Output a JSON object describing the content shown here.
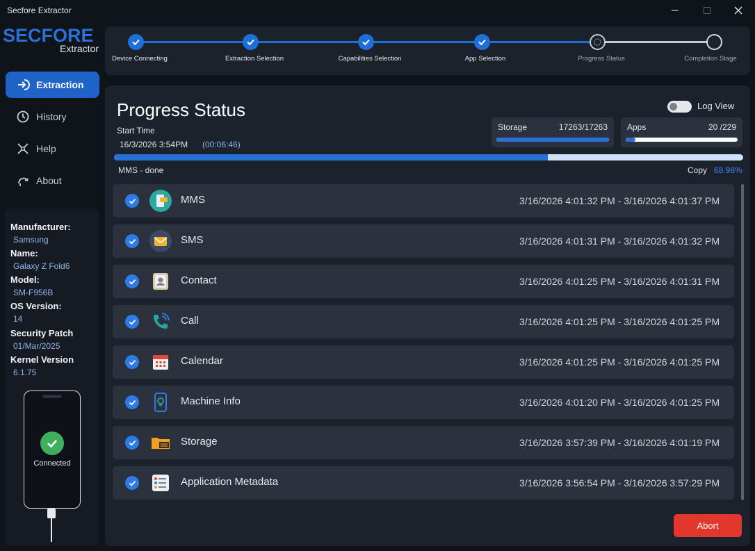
{
  "window": {
    "title": "Secfore Extractor"
  },
  "logo": {
    "main": "SECFORE",
    "sub": "Extractor"
  },
  "nav": [
    {
      "label": "Extraction",
      "icon": "extraction-icon",
      "active": true
    },
    {
      "label": "History",
      "icon": "history-icon",
      "active": false
    },
    {
      "label": "Help",
      "icon": "help-icon",
      "active": false
    },
    {
      "label": "About",
      "icon": "about-icon",
      "active": false
    }
  ],
  "device": {
    "manufacturer_label": "Manufacturer:",
    "manufacturer": "Samsung",
    "name_label": "Name:",
    "name": "Galaxy Z Fold6",
    "model_label": "Model:",
    "model": "SM-F956B",
    "os_label": "OS Version:",
    "os": "14",
    "patch_label": "Security Patch",
    "patch": "01/Mar/2025",
    "kernel_label": "Kernel Version",
    "kernel": "6.1.75",
    "status": "Connected"
  },
  "steps": [
    {
      "label": "Device Connecting",
      "state": "done"
    },
    {
      "label": "Extraction Selection",
      "state": "done"
    },
    {
      "label": "Capabilities Selection",
      "state": "done"
    },
    {
      "label": "App Selection",
      "state": "done"
    },
    {
      "label": "Progress Status",
      "state": "current"
    },
    {
      "label": "Completion Stage",
      "state": "pending"
    }
  ],
  "progress": {
    "title": "Progress Status",
    "start_label": "Start Time",
    "start_value": "16/3/2026 3:54PM",
    "elapsed": "(00:06:46)",
    "log_view_label": "Log View",
    "log_view_on": false,
    "storage": {
      "label": "Storage",
      "value": "17263/17263",
      "fraction": 1.0
    },
    "apps": {
      "label": "Apps",
      "value": "20 /229",
      "fraction": 0.087
    },
    "overall_fraction": 0.6898,
    "status_text": "MMS - done",
    "copy_label": "Copy",
    "copy_percent": "68.98%"
  },
  "items": [
    {
      "name": "MMS",
      "icon": "mms-icon",
      "time": "3/16/2026 4:01:32 PM - 3/16/2026 4:01:37 PM"
    },
    {
      "name": "SMS",
      "icon": "sms-icon",
      "time": "3/16/2026 4:01:31 PM - 3/16/2026 4:01:32 PM"
    },
    {
      "name": "Contact",
      "icon": "contact-icon",
      "time": "3/16/2026 4:01:25 PM - 3/16/2026 4:01:31 PM"
    },
    {
      "name": "Call",
      "icon": "call-icon",
      "time": "3/16/2026 4:01:25 PM - 3/16/2026 4:01:25 PM"
    },
    {
      "name": "Calendar",
      "icon": "calendar-icon",
      "time": "3/16/2026 4:01:25 PM - 3/16/2026 4:01:25 PM"
    },
    {
      "name": "Machine Info",
      "icon": "machine-info-icon",
      "time": "3/16/2026 4:01:20 PM - 3/16/2026 4:01:25 PM"
    },
    {
      "name": "Storage",
      "icon": "storage-folder-icon",
      "time": "3/16/2026 3:57:39 PM - 3/16/2026 4:01:19 PM"
    },
    {
      "name": "Application Metadata",
      "icon": "app-metadata-icon",
      "time": "3/16/2026 3:56:54 PM - 3/16/2026 3:57:29 PM"
    }
  ],
  "actions": {
    "abort_label": "Abort"
  },
  "colors": {
    "accent": "#1f6fd9",
    "abort": "#e2372c",
    "success": "#3fae5f"
  }
}
